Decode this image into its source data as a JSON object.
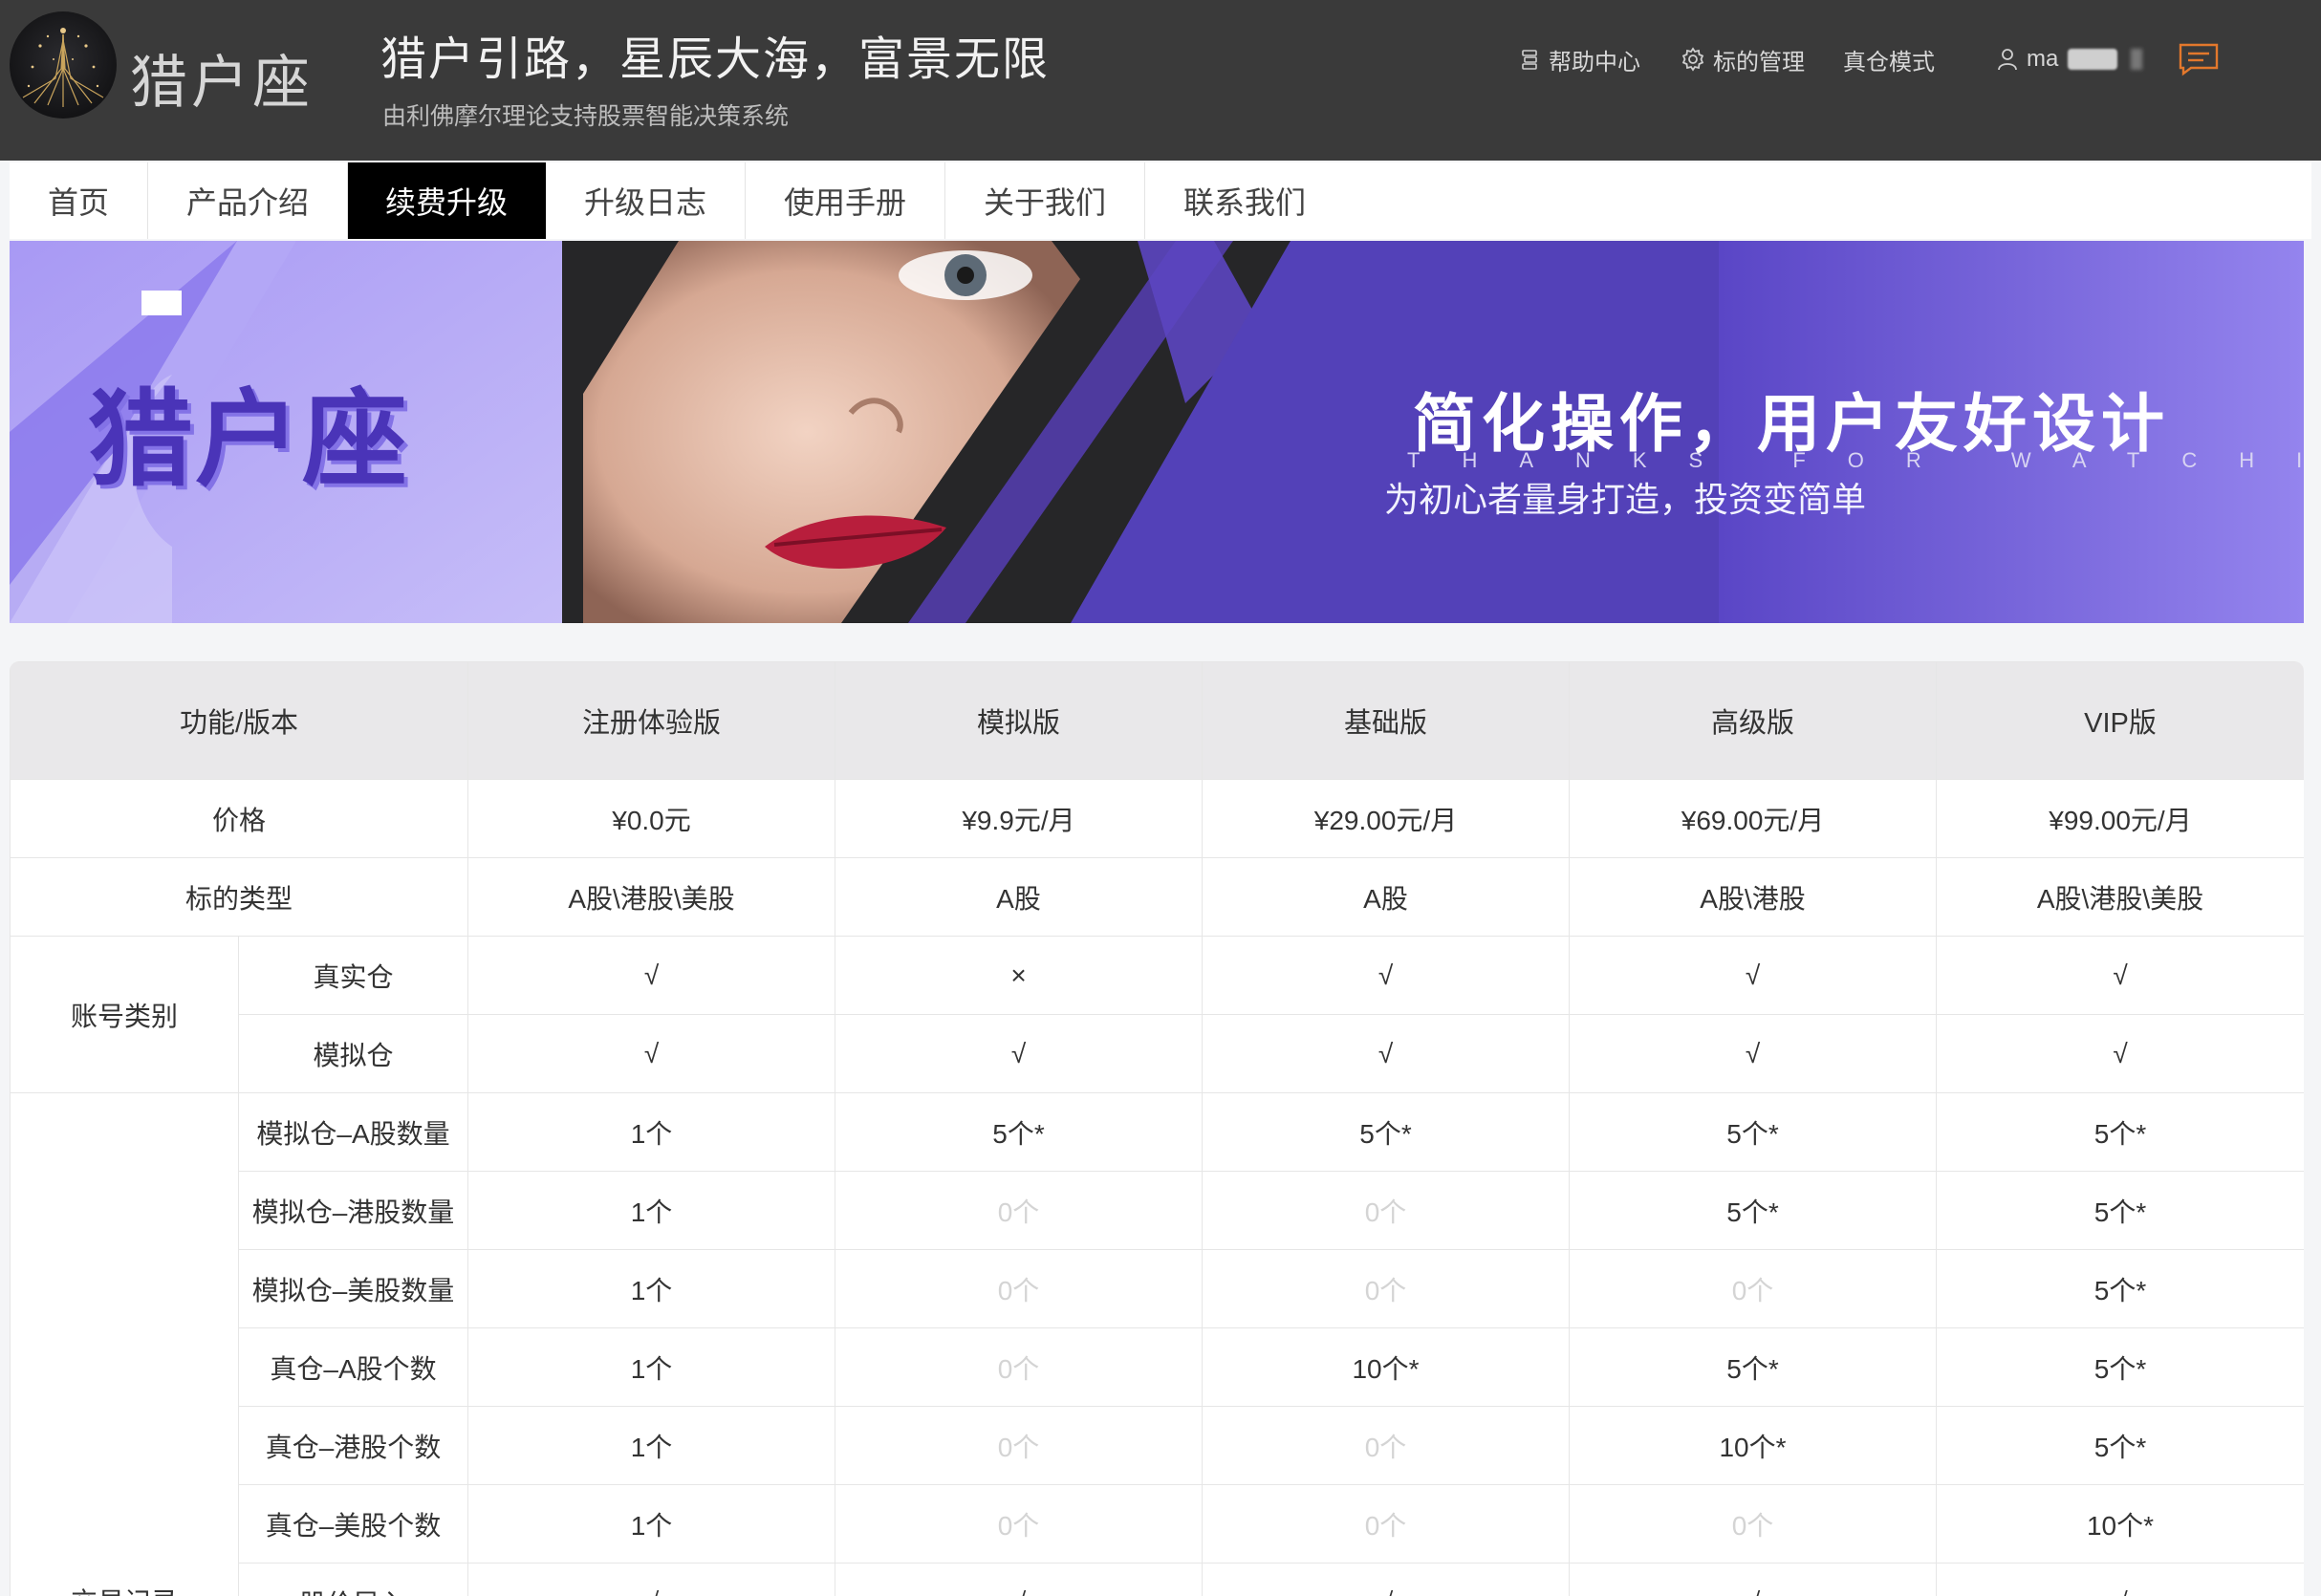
{
  "header": {
    "logo_text": "猎户座",
    "slogan": "猎户引路，星辰大海，富景无限",
    "subslogan": "由利佛摩尔理论支持股票智能决策系统",
    "nav": [
      {
        "label": "帮助中心",
        "icon": "help-list-icon"
      },
      {
        "label": "标的管理",
        "icon": "gear-icon"
      },
      {
        "label": "真仓模式",
        "icon": ""
      }
    ],
    "user": {
      "name": "ma",
      "icon": "user-icon"
    },
    "message_icon": "message-icon"
  },
  "tabs": [
    {
      "label": "首页",
      "active": false
    },
    {
      "label": "产品介绍",
      "active": false
    },
    {
      "label": "续费升级",
      "active": true
    },
    {
      "label": "升级日志",
      "active": false
    },
    {
      "label": "使用手册",
      "active": false
    },
    {
      "label": "关于我们",
      "active": false
    },
    {
      "label": "联系我们",
      "active": false
    }
  ],
  "banner": {
    "brand": "猎户座",
    "headline": "简化操作，用户友好设计",
    "thanks": "THANKS FOR WATCHING",
    "subline": "为初心者量身打造，投资变简单",
    "colors": {
      "purple": "#7f6ae6",
      "dark": "#262628"
    }
  },
  "pricing": {
    "header": [
      "功能/版本",
      "注册体验版",
      "模拟版",
      "基础版",
      "高级版",
      "VIP版"
    ],
    "price": {
      "label": "价格",
      "values": [
        "¥0.0元",
        "¥9.9元/月",
        "¥29.00元/月",
        "¥69.00元/月",
        "¥99.00元/月"
      ]
    },
    "asset_type": {
      "label": "标的类型",
      "values": [
        "A股\\港股\\美股",
        "A股",
        "A股",
        "A股\\港股",
        "A股\\港股\\美股"
      ]
    },
    "account": {
      "label": "账号类别",
      "rows": [
        {
          "label": "真实仓",
          "values": [
            "√",
            "×",
            "√",
            "√",
            "√"
          ]
        },
        {
          "label": "模拟仓",
          "values": [
            "√",
            "√",
            "√",
            "√",
            "√"
          ]
        }
      ]
    },
    "trade": {
      "label": "交易记录",
      "rows": [
        {
          "label": "模拟仓–A股数量",
          "values": [
            "1个",
            "5个*",
            "5个*",
            "5个*",
            "5个*"
          ],
          "muted": [
            false,
            false,
            false,
            false,
            false
          ]
        },
        {
          "label": "模拟仓–港股数量",
          "values": [
            "1个",
            "0个",
            "0个",
            "5个*",
            "5个*"
          ],
          "muted": [
            false,
            true,
            true,
            false,
            false
          ]
        },
        {
          "label": "模拟仓–美股数量",
          "values": [
            "1个",
            "0个",
            "0个",
            "0个",
            "5个*"
          ],
          "muted": [
            false,
            true,
            true,
            true,
            false
          ]
        },
        {
          "label": "真仓–A股个数",
          "values": [
            "1个",
            "0个",
            "10个*",
            "5个*",
            "5个*"
          ],
          "muted": [
            false,
            true,
            false,
            false,
            false
          ]
        },
        {
          "label": "真仓–港股个数",
          "values": [
            "1个",
            "0个",
            "0个",
            "10个*",
            "5个*"
          ],
          "muted": [
            false,
            true,
            true,
            false,
            false
          ]
        },
        {
          "label": "真仓–美股个数",
          "values": [
            "1个",
            "0个",
            "0个",
            "0个",
            "10个*"
          ],
          "muted": [
            false,
            true,
            true,
            true,
            false
          ]
        },
        {
          "label": "股价导入",
          "values": [
            "√",
            "√",
            "√",
            "√",
            "√"
          ],
          "muted": [
            false,
            false,
            false,
            false,
            false
          ]
        }
      ]
    }
  }
}
